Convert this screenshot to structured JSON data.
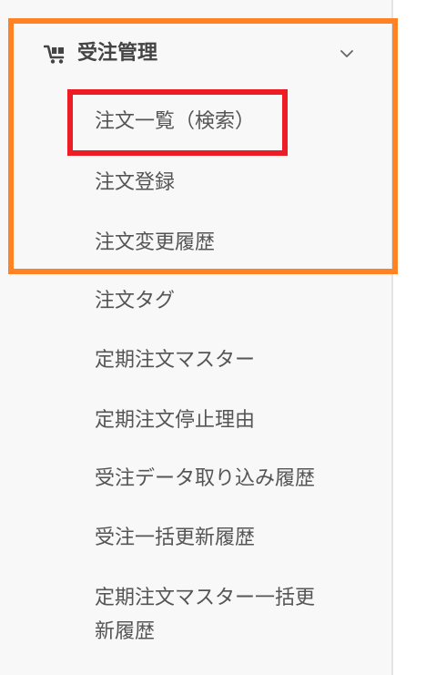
{
  "section": {
    "title": "受注管理",
    "icon": "cart-icon",
    "toggle_icon": "chevron-down-icon"
  },
  "menu": {
    "items": [
      {
        "label": "注文一覧（検索）"
      },
      {
        "label": "注文登録"
      },
      {
        "label": "注文変更履歴"
      },
      {
        "label": "注文タグ"
      },
      {
        "label": "定期注文マスター"
      },
      {
        "label": "定期注文停止理由"
      },
      {
        "label": "受注データ取り込み履歴"
      },
      {
        "label": "受注一括更新履歴"
      },
      {
        "label": "定期注文マスター一括更"
      },
      {
        "label": "新履歴"
      }
    ]
  },
  "highlight_colors": {
    "outer": "#ff8225",
    "inner": "#ee1c25"
  }
}
